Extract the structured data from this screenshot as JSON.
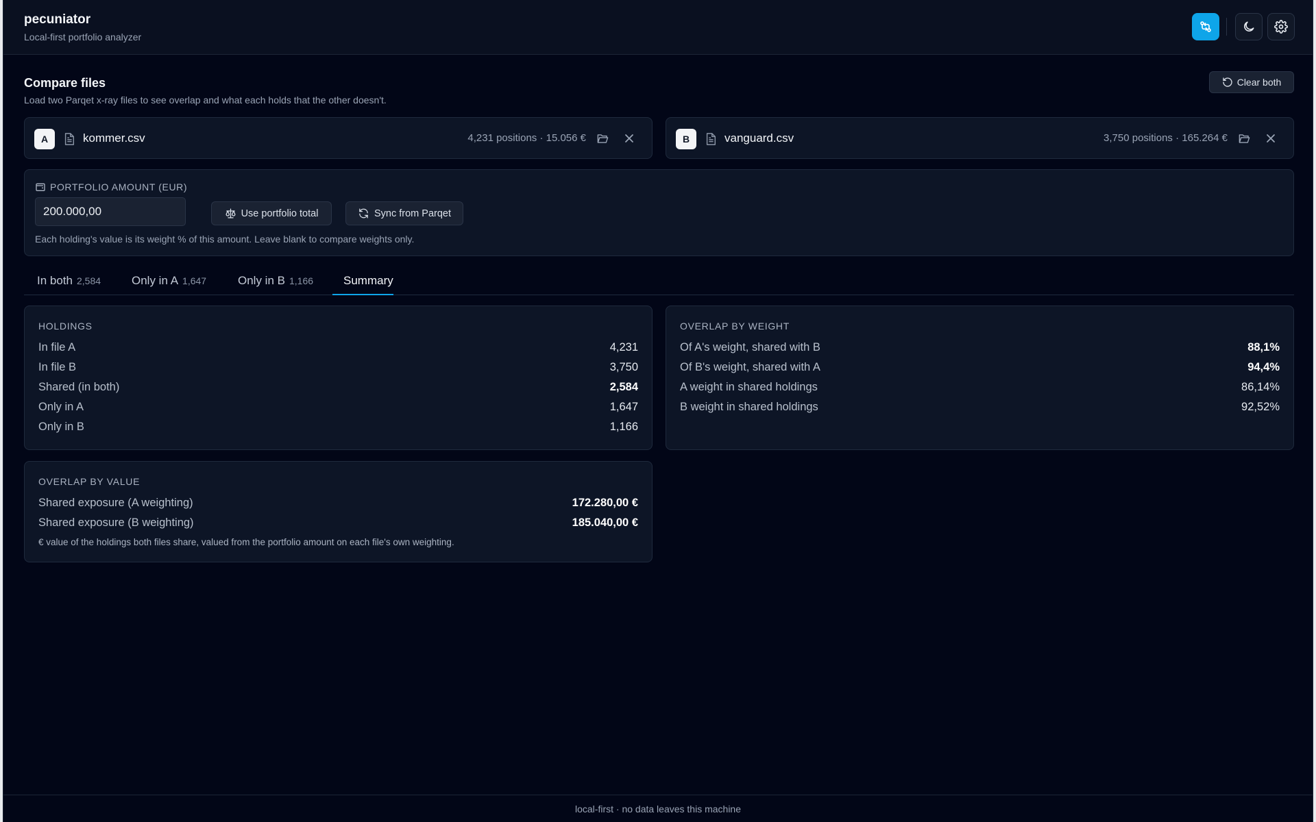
{
  "app": {
    "title": "pecuniator",
    "subtitle": "Local-first portfolio analyzer"
  },
  "header_icons": [
    "compare-icon",
    "moon-icon",
    "gear-icon"
  ],
  "compare": {
    "title": "Compare files",
    "description": "Load two Parqet x-ray files to see overlap and what each holds that the other doesn't.",
    "clear_label": "Clear both"
  },
  "files": {
    "a": {
      "badge": "A",
      "name": "kommer.csv",
      "meta": "4,231 positions · 15.056 €"
    },
    "b": {
      "badge": "B",
      "name": "vanguard.csv",
      "meta": "3,750 positions · 165.264 €"
    }
  },
  "amount": {
    "label": "PORTFOLIO AMOUNT (EUR)",
    "value": "200.000,00",
    "use_total_label": "Use portfolio total",
    "sync_label": "Sync from Parqet",
    "help": "Each holding's value is its weight % of this amount. Leave blank to compare weights only."
  },
  "tabs": [
    {
      "label": "In both",
      "count": "2,584"
    },
    {
      "label": "Only in A",
      "count": "1,647"
    },
    {
      "label": "Only in B",
      "count": "1,166"
    },
    {
      "label": "Summary",
      "count": ""
    }
  ],
  "active_tab": "Summary",
  "holdings": {
    "title": "HOLDINGS",
    "rows": [
      {
        "label": "In file A",
        "value": "4,231"
      },
      {
        "label": "In file B",
        "value": "3,750"
      },
      {
        "label": "Shared (in both)",
        "value": "2,584"
      },
      {
        "label": "Only in A",
        "value": "1,647"
      },
      {
        "label": "Only in B",
        "value": "1,166"
      }
    ]
  },
  "overlap_weight": {
    "title": "OVERLAP BY WEIGHT",
    "rows": [
      {
        "label": "Of A's weight, shared with B",
        "value": "88,1%"
      },
      {
        "label": "Of B's weight, shared with A",
        "value": "94,4%"
      },
      {
        "label": "A weight in shared holdings",
        "value": "86,14%"
      },
      {
        "label": "B weight in shared holdings",
        "value": "92,52%"
      }
    ]
  },
  "overlap_value": {
    "title": "OVERLAP BY VALUE",
    "rows": [
      {
        "label": "Shared exposure (A weighting)",
        "value": "172.280,00 €"
      },
      {
        "label": "Shared exposure (B weighting)",
        "value": "185.040,00 €"
      }
    ],
    "note": "€ value of the holdings both files share, valued from the portfolio amount on each file's own weighting."
  },
  "footer": "local-first · no data leaves this machine",
  "colors": {
    "accent": "#0ea5e9",
    "background": "#020617",
    "card": "#0d1526"
  }
}
